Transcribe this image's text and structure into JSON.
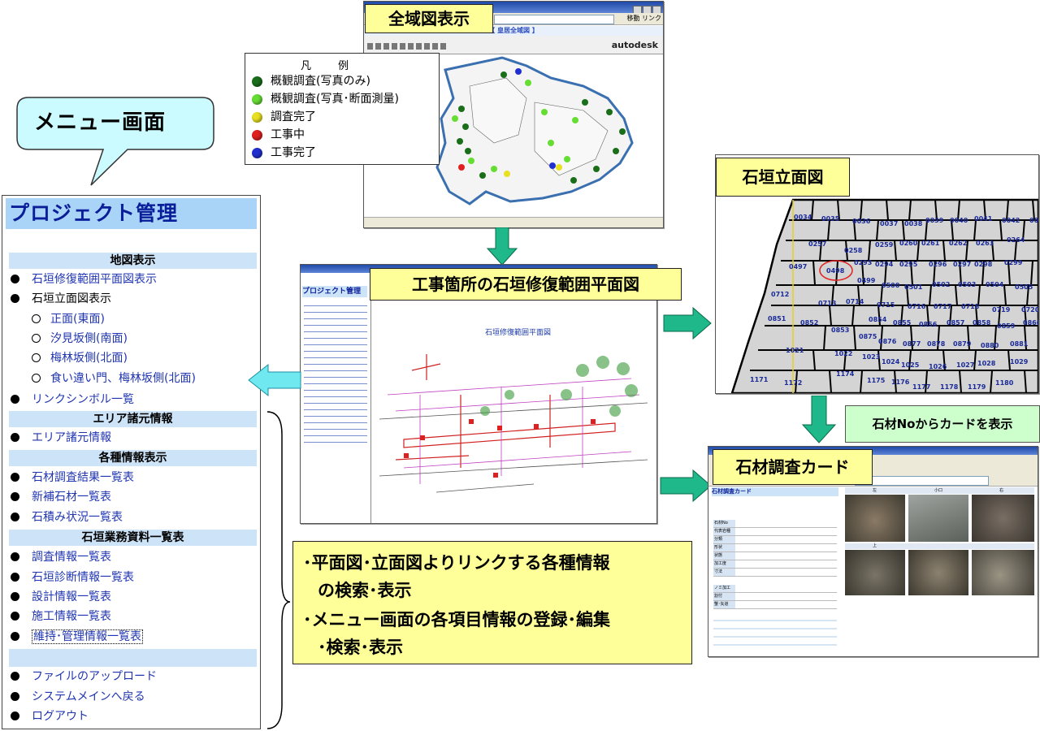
{
  "callouts": {
    "zenikizu": "全域図表示",
    "menu_bubble": "メニュー画面",
    "plan": "工事箇所の石垣修復範囲平面図",
    "elevation": "石垣立面図",
    "card_note": "石材Noからカードを表示",
    "card": "石材調査カード"
  },
  "legend": {
    "title": "凡　例",
    "items": [
      {
        "label": "概観調査(写真のみ)",
        "color": "#1a6e1a"
      },
      {
        "label": "概観調査(写真･断面測量)",
        "color": "#66dd33"
      },
      {
        "label": "調査完了",
        "color": "#e8e020"
      },
      {
        "label": "工事中",
        "color": "#e02020"
      },
      {
        "label": "工事完了",
        "color": "#2030d0"
      }
    ]
  },
  "map_window": {
    "header": "【 皇居全域図 】",
    "brand": "autodesk",
    "addr_buttons": "移動 リンク"
  },
  "menu": {
    "title": "プロジェクト管理",
    "sections": [
      {
        "label": "地図表示"
      },
      {
        "label": "エリア諸元情報"
      },
      {
        "label": "各種情報表示"
      },
      {
        "label": "石垣業務資料一覧表"
      }
    ],
    "items": {
      "i1": "石垣修復範囲平面図表示",
      "i2": "石垣立面図表示",
      "s1": "正面(東面)",
      "s2": "汐見坂側(南面)",
      "s3": "梅林坂側(北面)",
      "s4": "食い違い門、梅林坂側(北面)",
      "i3": "リンクシンボル一覧",
      "a1": "エリア諸元情報",
      "b1": "石材調査結果一覧表",
      "b2": "新補石材一覧表",
      "b3": "石積み状況一覧表",
      "c1": "調査情報一覧表",
      "c2": "石垣診断情報一覧表",
      "c3": "設計情報一覧表",
      "c4": "施工情報一覧表",
      "c5": "維持･管理情報一覧表",
      "d1": "ファイルのアップロード",
      "d2": "システムメインへ戻る",
      "d3": "ログアウト"
    }
  },
  "info_box": {
    "line1": "･平面図･立面図よりリンクする各種情報",
    "line2": "の検索･表示",
    "line3": "･メニュー画面の各項目情報の登録･編集",
    "line4": "･検索･表示"
  },
  "plan_window": {
    "sidebar_title": "プロジェクト管理",
    "drawing_title": "石垣修復範囲平面図"
  },
  "elevation": {
    "stones": [
      "0034",
      "0035",
      "0036",
      "0037",
      "0038",
      "0039",
      "0040",
      "0041",
      "0042",
      "0043",
      "0257",
      "0258",
      "0259",
      "0260",
      "0261",
      "0262",
      "0263",
      "0264",
      "0497",
      "0498",
      "0293",
      "0294",
      "0295",
      "0296",
      "0297",
      "0298",
      "0299",
      "0499",
      "0500",
      "0501",
      "0502",
      "0503",
      "0504",
      "0505",
      "0712",
      "0713",
      "0714",
      "0715",
      "0716",
      "0717",
      "0718",
      "0719",
      "0720",
      "0851",
      "0852",
      "0853",
      "0854",
      "0855",
      "0856",
      "0857",
      "0858",
      "0859",
      "0860",
      "0875",
      "0876",
      "0877",
      "0878",
      "0879",
      "0880",
      "0881",
      "1021",
      "1022",
      "1023",
      "1024",
      "1025",
      "1026",
      "1027",
      "1028",
      "1029",
      "1171",
      "1172",
      "1174",
      "1175",
      "1176",
      "1177",
      "1178",
      "1179",
      "1180"
    ],
    "highlighted": "0498"
  },
  "card_window": {
    "title": "石材調査カード",
    "photo_headers": [
      "左",
      "小口",
      "右",
      "上"
    ],
    "rows": [
      "石材No",
      "代表岩種",
      "分類",
      "形状",
      "状態",
      "加工度",
      "寸法",
      "ノミ加工",
      "割付",
      "蟹･矢道"
    ]
  }
}
